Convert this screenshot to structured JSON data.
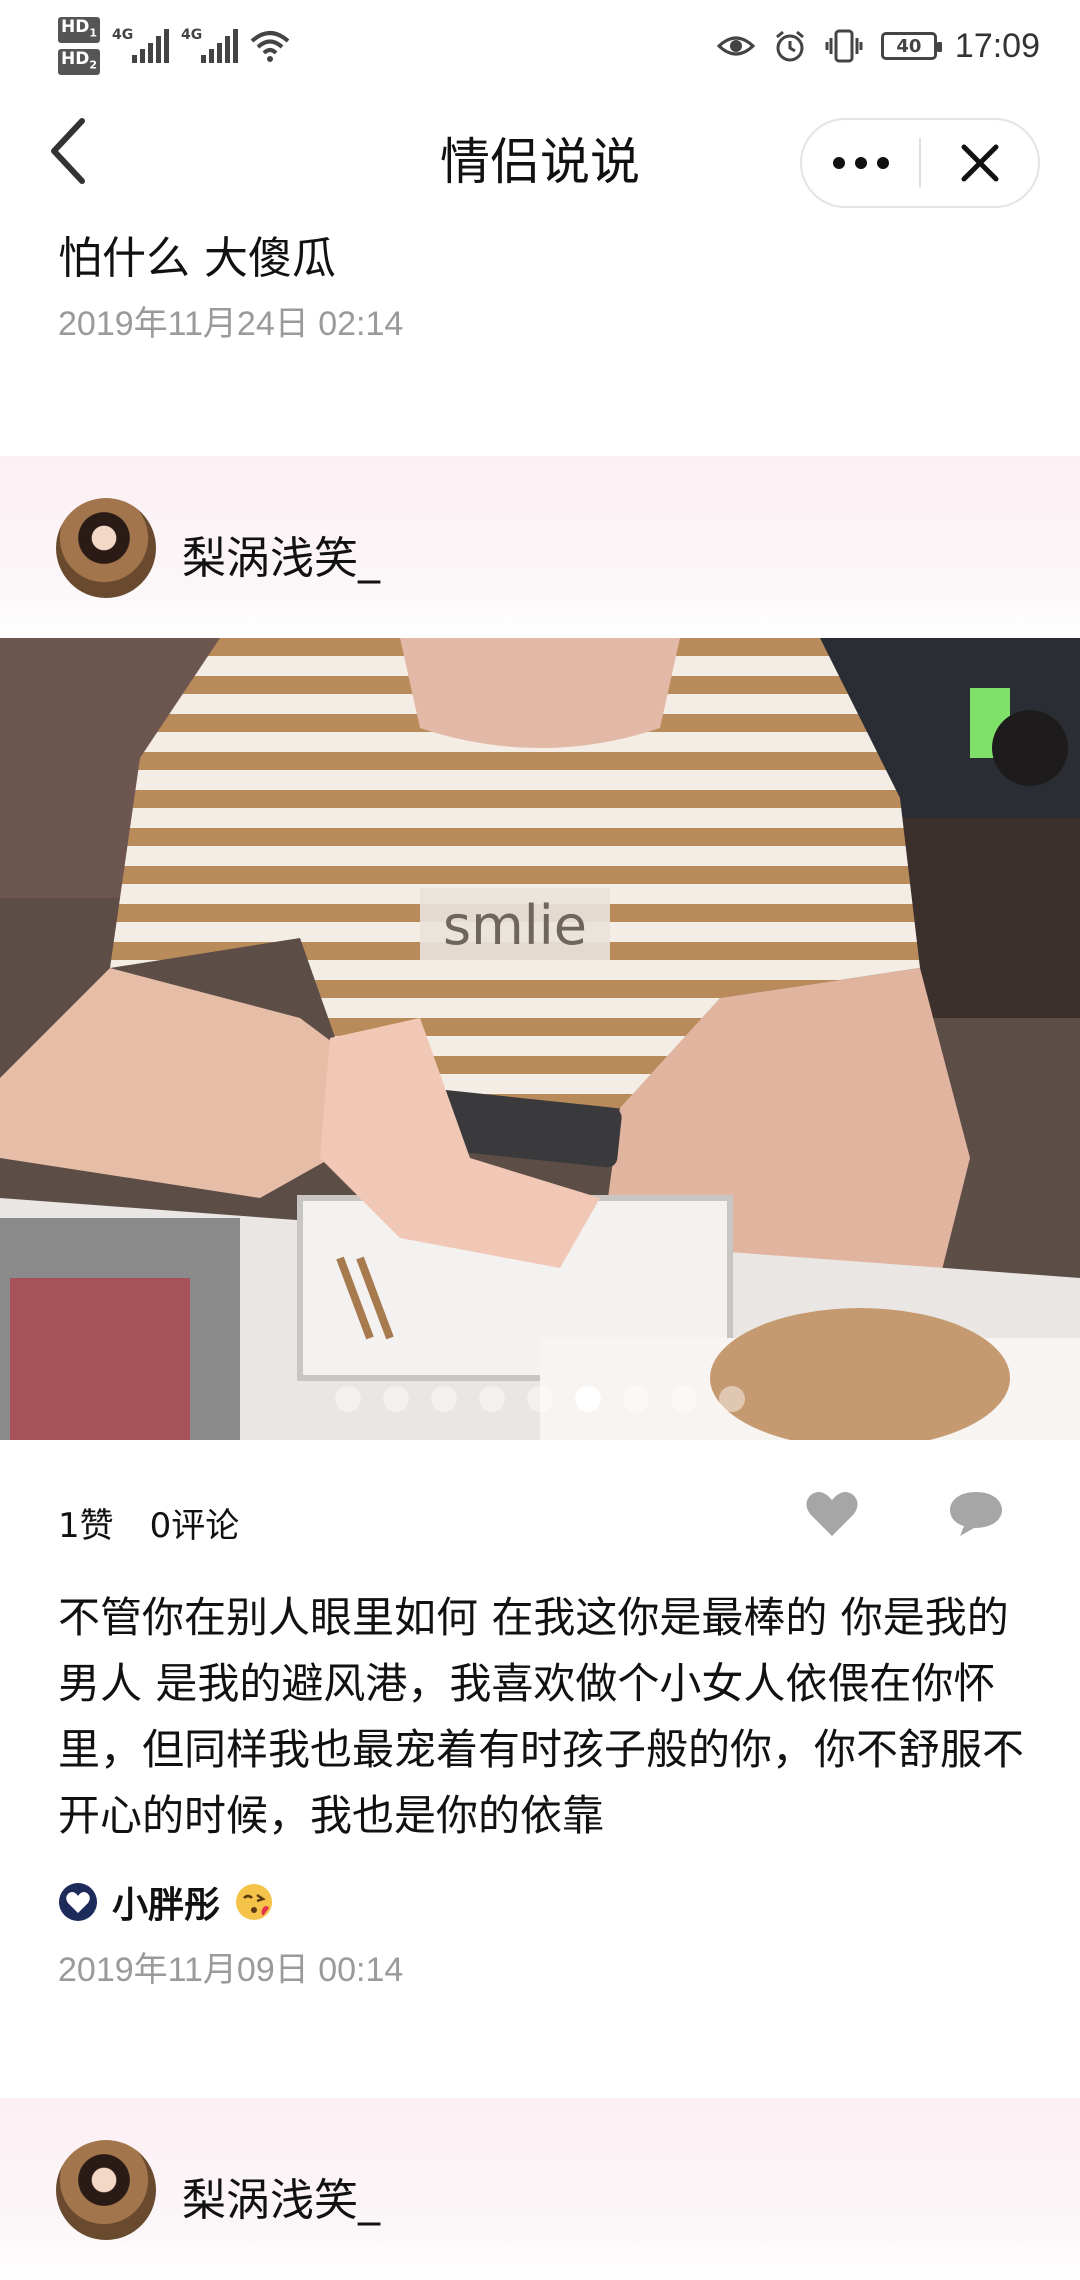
{
  "status_bar": {
    "hd1": "HD",
    "hd1_sub": "1",
    "hd2": "HD",
    "hd2_sub": "2",
    "net1": "4G",
    "net2": "4G",
    "battery": "40",
    "time": "17:09"
  },
  "header": {
    "title": "情侣说说"
  },
  "posts": [
    {
      "text": "怕什么 大傻瓜",
      "timestamp": "2019年11月24日 02:14"
    },
    {
      "author": "梨涡浅笑_",
      "photo": {
        "shirt_text": "smlie",
        "page_count": 9,
        "active_page": 6
      },
      "likes": "1赞",
      "comments": "0评论",
      "text": "不管你在别人眼里如何 在我这你是最棒的 你是我的男人 是我的避风港，我喜欢做个小女人依偎在你怀里，但同样我也最宠着有时孩子般的你，你不舒服不开心的时候，我也是你的依靠",
      "lover_name": "小胖彤",
      "timestamp": "2019年11月09日 00:14"
    },
    {
      "author": "梨涡浅笑_"
    }
  ],
  "colors": {
    "band_pink": "#fdf0f4",
    "timestamp_gray": "#9a9a9a",
    "icon_gray": "#a6a6a6",
    "lover_heart": "#1c2b5a"
  }
}
